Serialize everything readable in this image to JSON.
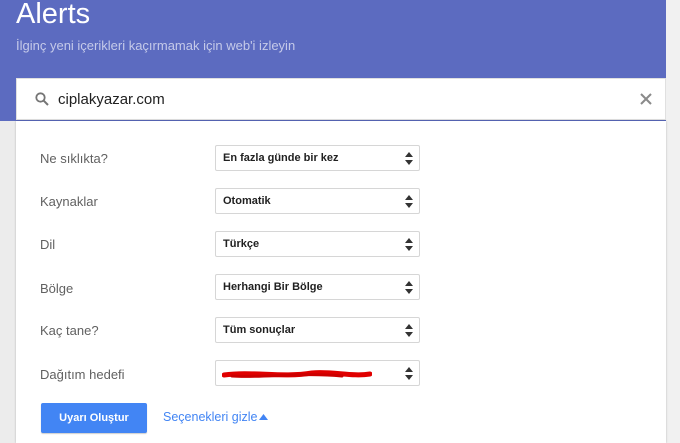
{
  "header": {
    "title": "Alerts",
    "subtitle": "İlginç yeni içerikleri kaçırmamak için web'i izleyin",
    "background_color": "#5c6bc0"
  },
  "search": {
    "value": "ciplakyazar.com",
    "icon": "search-icon",
    "clear_icon": "close-icon"
  },
  "options": [
    {
      "label": "Ne sıklıkta?",
      "value": "En fazla günde bir kez"
    },
    {
      "label": "Kaynaklar",
      "value": "Otomatik"
    },
    {
      "label": "Dil",
      "value": "Türkçe"
    },
    {
      "label": "Bölge",
      "value": "Herhangi Bir Bölge"
    },
    {
      "label": "Kaç tane?",
      "value": "Tüm sonuçlar"
    },
    {
      "label": "Dağıtım hedefi",
      "value": ""
    }
  ],
  "actions": {
    "create_label": "Uyarı Oluştur",
    "hide_options_label": "Seçenekleri gizle",
    "primary_color": "#4285f4"
  }
}
